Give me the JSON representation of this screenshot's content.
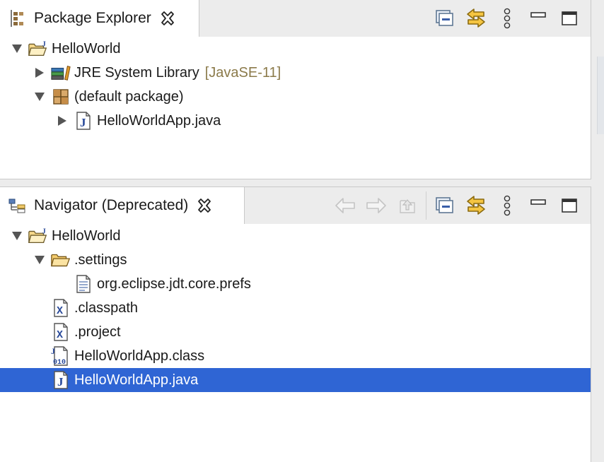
{
  "package_explorer": {
    "title": "Package Explorer",
    "toolbar": [
      "collapse-all-icon",
      "link-with-editor-icon",
      "view-menu-icon",
      "minimize-icon",
      "maximize-icon"
    ],
    "tree": [
      {
        "label": "HelloWorld",
        "icon": "java-project-icon",
        "expanded": true,
        "level": 0
      },
      {
        "label": "JRE System Library",
        "decoration": "[JavaSE-11]",
        "icon": "library-icon",
        "expanded": false,
        "level": 1
      },
      {
        "label": "(default package)",
        "icon": "package-icon",
        "expanded": true,
        "level": 1
      },
      {
        "label": "HelloWorldApp.java",
        "icon": "java-file-icon",
        "expanded": false,
        "level": 2
      }
    ]
  },
  "navigator": {
    "title": "Navigator (Deprecated)",
    "toolbar": [
      "back-icon",
      "forward-icon",
      "up-icon",
      "collapse-all-icon",
      "link-with-editor-icon",
      "view-menu-icon",
      "minimize-icon",
      "maximize-icon"
    ],
    "tree": [
      {
        "label": "HelloWorld",
        "icon": "java-project-icon",
        "expanded": true,
        "level": 0
      },
      {
        "label": ".settings",
        "icon": "folder-icon",
        "expanded": true,
        "level": 1
      },
      {
        "label": "org.eclipse.jdt.core.prefs",
        "icon": "text-file-icon",
        "level": 2
      },
      {
        "label": ".classpath",
        "icon": "xml-file-icon",
        "level": 1
      },
      {
        "label": ".project",
        "icon": "xml-file-icon",
        "level": 1
      },
      {
        "label": "HelloWorldApp.class",
        "icon": "class-file-icon",
        "level": 1
      },
      {
        "label": "HelloWorldApp.java",
        "icon": "java-file-icon",
        "level": 1,
        "selected": true
      }
    ]
  },
  "colors": {
    "selection": "#2f65d4",
    "decoration": "#8b7a4a",
    "accent_orange": "#d4a017"
  }
}
